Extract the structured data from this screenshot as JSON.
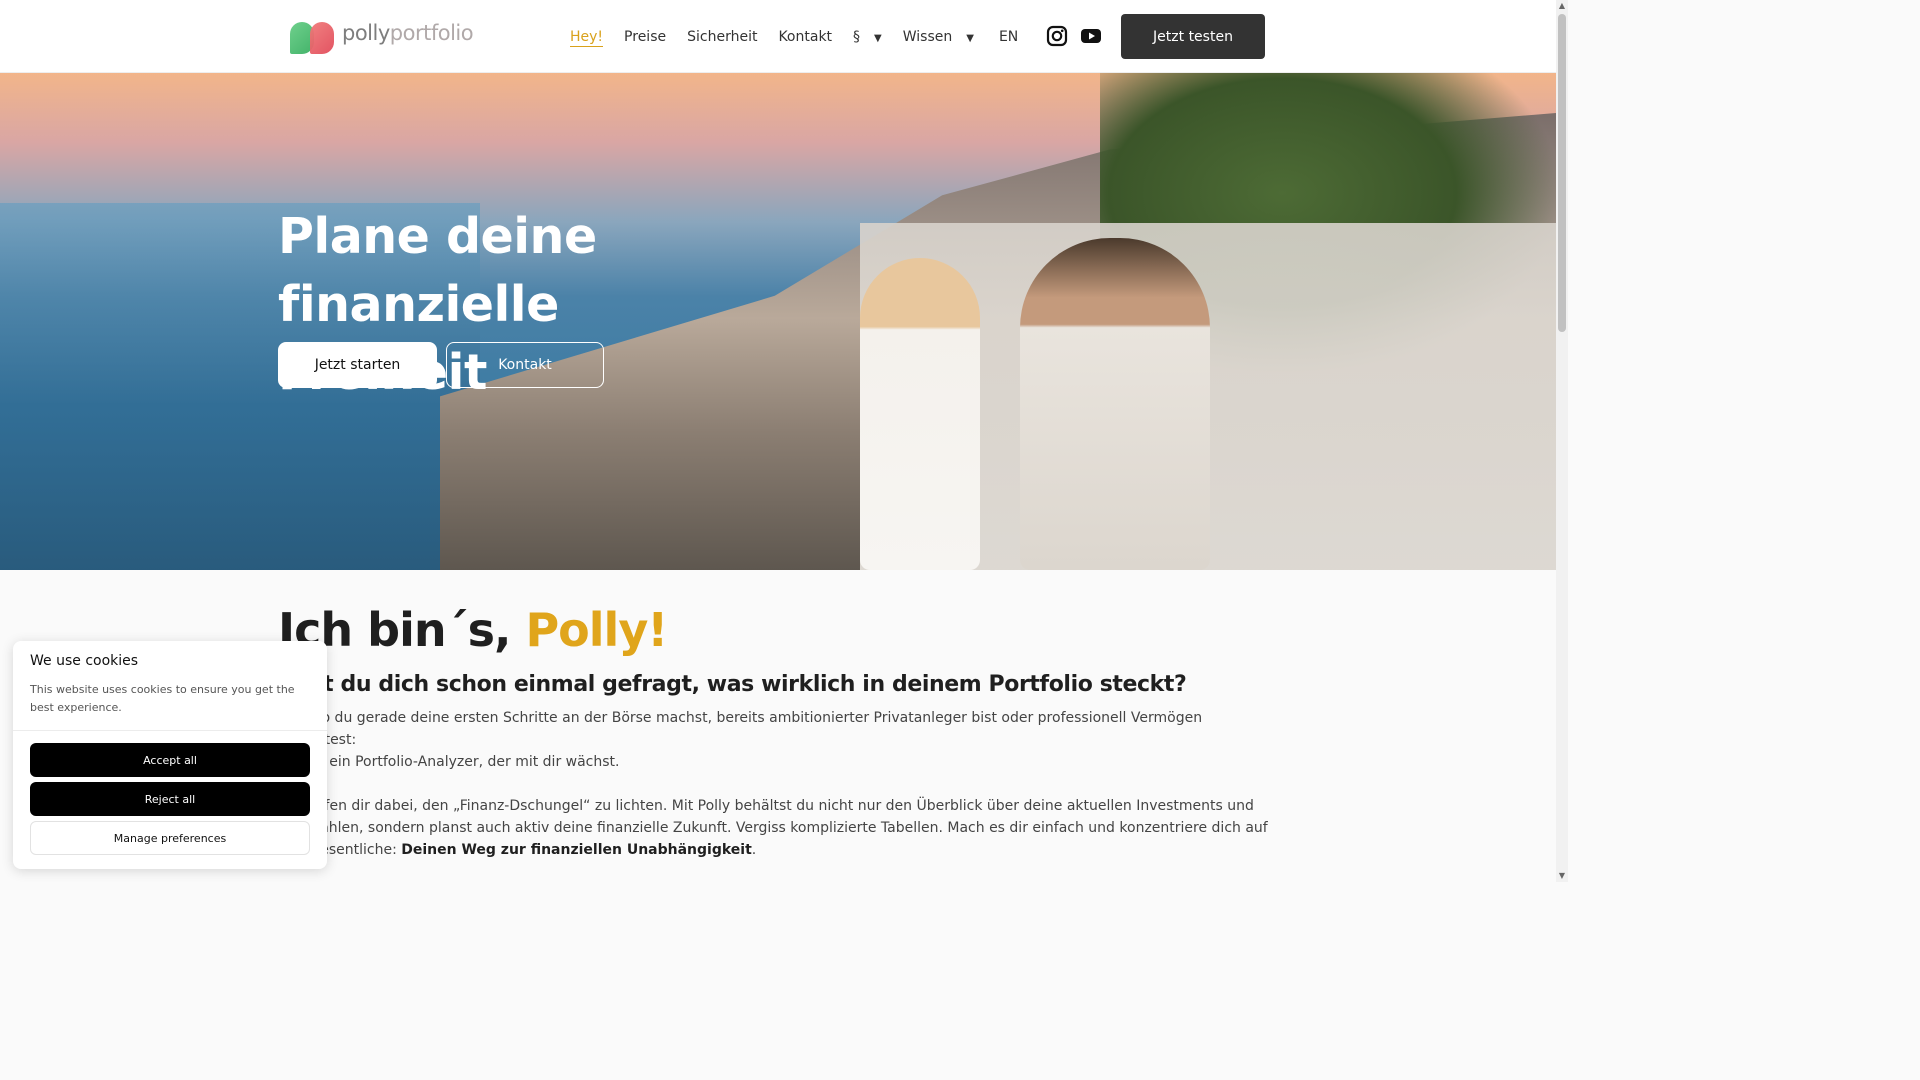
{
  "header": {
    "logo_text_1": "polly",
    "logo_text_2": "portfolio",
    "nav": [
      {
        "label": "Hey!",
        "active": true
      },
      {
        "label": "Preise"
      },
      {
        "label": "Sicherheit"
      },
      {
        "label": "Kontakt"
      },
      {
        "label": "§",
        "dropdown": true
      },
      {
        "label": "Wissen",
        "dropdown": true
      },
      {
        "label": "EN"
      }
    ],
    "caret": "▼",
    "social": [
      "instagram-icon",
      "youtube-icon"
    ],
    "cta": "Jetzt testen"
  },
  "hero": {
    "title_line1": "Plane deine",
    "title_line2": "finanzielle Freiheit",
    "primary_button": "Jetzt starten",
    "secondary_button": "Kontakt"
  },
  "intro": {
    "heading_prefix": "Ich bin´s, ",
    "heading_accent": "Polly!",
    "subheading": "Hast du dich schon einmal gefragt, was wirklich in deinem Portfolio steckt?",
    "p1_line1": "Egal ob du gerade deine ersten Schritte an der Börse machst, bereits ambitionierter Privatanleger bist oder professionell Vermögen verwaltest:",
    "p1_line2": "Ich bin ein Portfolio-Analyzer, der mit dir wächst.",
    "p2_text": "Ich helfen dir dabei, den „Finanz-Dschungel“ zu lichten. Mit Polly behältst du nicht nur den Überblick über deine aktuellen Investments und Kennzahlen, sondern planst auch aktiv deine finanzielle Zukunft. Vergiss komplizierte Tabellen. Mach es dir einfach und konzentriere dich auf das Wesentliche: ",
    "p2_bold": "Deinen Weg zur finanziellen Unabhängigkeit",
    "p2_end": "."
  },
  "cookie": {
    "title": "We use cookies",
    "description": "This website uses cookies to ensure you get the best experience.",
    "accept": "Accept all",
    "reject": "Reject all",
    "manage": "Manage preferences"
  },
  "colors": {
    "accent": "#e0a51b",
    "nav_active": "#d9a21c",
    "cta_bg": "#333333"
  }
}
